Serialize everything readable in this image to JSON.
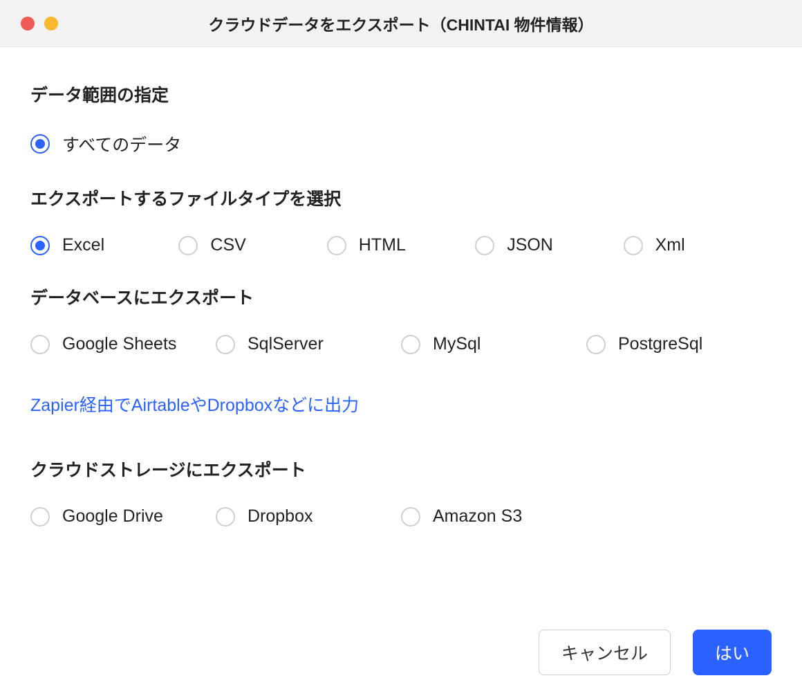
{
  "window": {
    "title": "クラウドデータをエクスポート（CHINTAI 物件情報）"
  },
  "sections": {
    "dataRange": {
      "header": "データ範囲の指定",
      "options": {
        "all": {
          "label": "すべてのデータ",
          "selected": true
        }
      }
    },
    "fileType": {
      "header": "エクスポートするファイルタイプを選択",
      "options": {
        "excel": {
          "label": "Excel",
          "selected": true
        },
        "csv": {
          "label": "CSV",
          "selected": false
        },
        "html": {
          "label": "HTML",
          "selected": false
        },
        "json": {
          "label": "JSON",
          "selected": false
        },
        "xml": {
          "label": "Xml",
          "selected": false
        }
      }
    },
    "database": {
      "header": "データベースにエクスポート",
      "options": {
        "googleSheets": {
          "label": "Google Sheets",
          "selected": false
        },
        "sqlServer": {
          "label": "SqlServer",
          "selected": false
        },
        "mysql": {
          "label": "MySql",
          "selected": false
        },
        "postgresql": {
          "label": "PostgreSql",
          "selected": false
        }
      }
    },
    "zapierLink": {
      "label": "Zapier経由でAirtableやDropboxなどに出力"
    },
    "cloudStorage": {
      "header": "クラウドストレージにエクスポート",
      "options": {
        "googleDrive": {
          "label": "Google Drive",
          "selected": false
        },
        "dropbox": {
          "label": "Dropbox",
          "selected": false
        },
        "amazonS3": {
          "label": "Amazon S3",
          "selected": false
        }
      }
    }
  },
  "footer": {
    "cancel": "キャンセル",
    "confirm": "はい"
  }
}
